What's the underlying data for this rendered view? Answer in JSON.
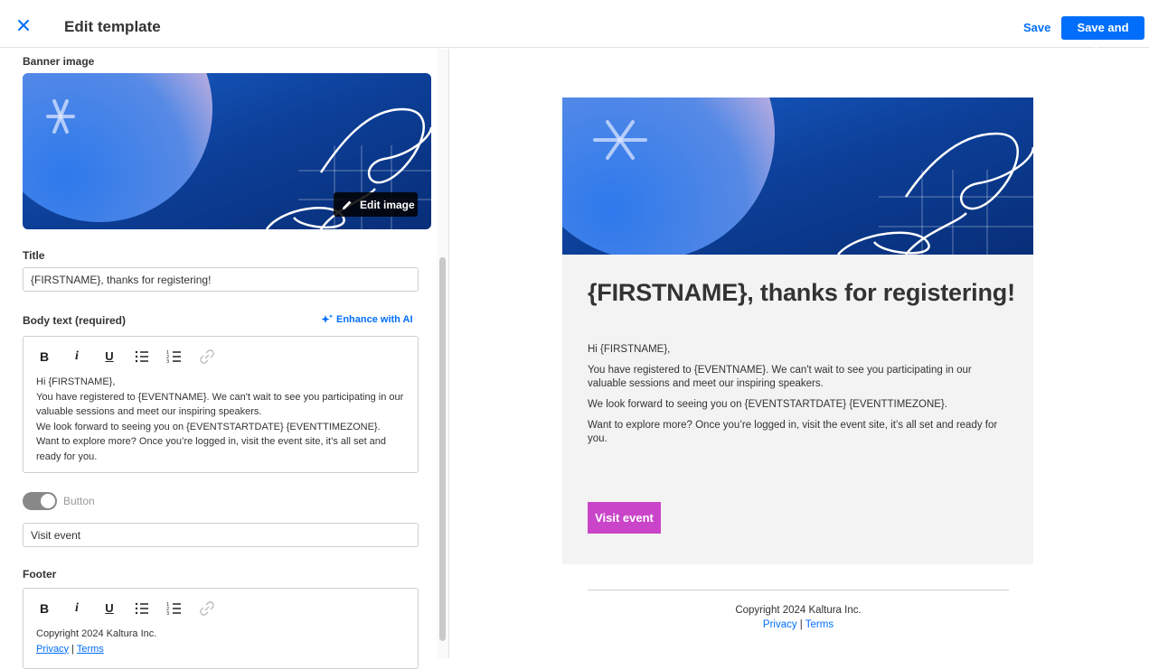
{
  "header": {
    "title": "Edit template",
    "save_label": "Save",
    "save_close_label": "Save and close"
  },
  "colors": {
    "accent": "#006efa",
    "button_preview": "#c944c9",
    "banner_dark": "#0a3a8c",
    "banner_light": "#f2c4e0"
  },
  "form": {
    "banner_label": "Banner image",
    "edit_image_label": "Edit image",
    "title_label": "Title",
    "title_value": "{FIRSTNAME}, thanks for registering!",
    "body_label": "Body text (required)",
    "enhance_label": "Enhance with AI",
    "body_lines": [
      "Hi {FIRSTNAME},",
      "You have registered to {EVENTNAME}. We can't wait to see you participating in our",
      "valuable sessions and meet our inspiring speakers.",
      "We look forward to seeing you on {EVENTSTARTDATE} {EVENTTIMEZONE}.",
      "Want to explore more? Once you’re logged in, visit the event site, it’s all set and",
      "ready for you."
    ],
    "button_toggle_label": "Button",
    "button_value": "Visit event",
    "footer_label": "Footer",
    "footer_copyright": "Copyright 2024 Kaltura Inc.",
    "footer_privacy": "Privacy",
    "footer_sep": " | ",
    "footer_terms": "Terms"
  },
  "toolbar": {
    "bold": "B",
    "italic": "i",
    "underline": "U"
  },
  "preview": {
    "title": "{FIRSTNAME}, thanks for registering!",
    "paragraphs": [
      "Hi {FIRSTNAME},",
      "You have registered to {EVENTNAME}. We can't wait to see you participating in our valuable sessions and meet our inspiring speakers.",
      "We look forward to seeing you on {EVENTSTARTDATE} {EVENTTIMEZONE}.",
      "Want to explore more? Once you’re logged in, visit the event site, it’s all set and ready for you."
    ],
    "button_label": "Visit event",
    "footer_copyright": "Copyright 2024 Kaltura Inc.",
    "footer_privacy": "Privacy",
    "footer_sep": " | ",
    "footer_terms": "Terms"
  }
}
